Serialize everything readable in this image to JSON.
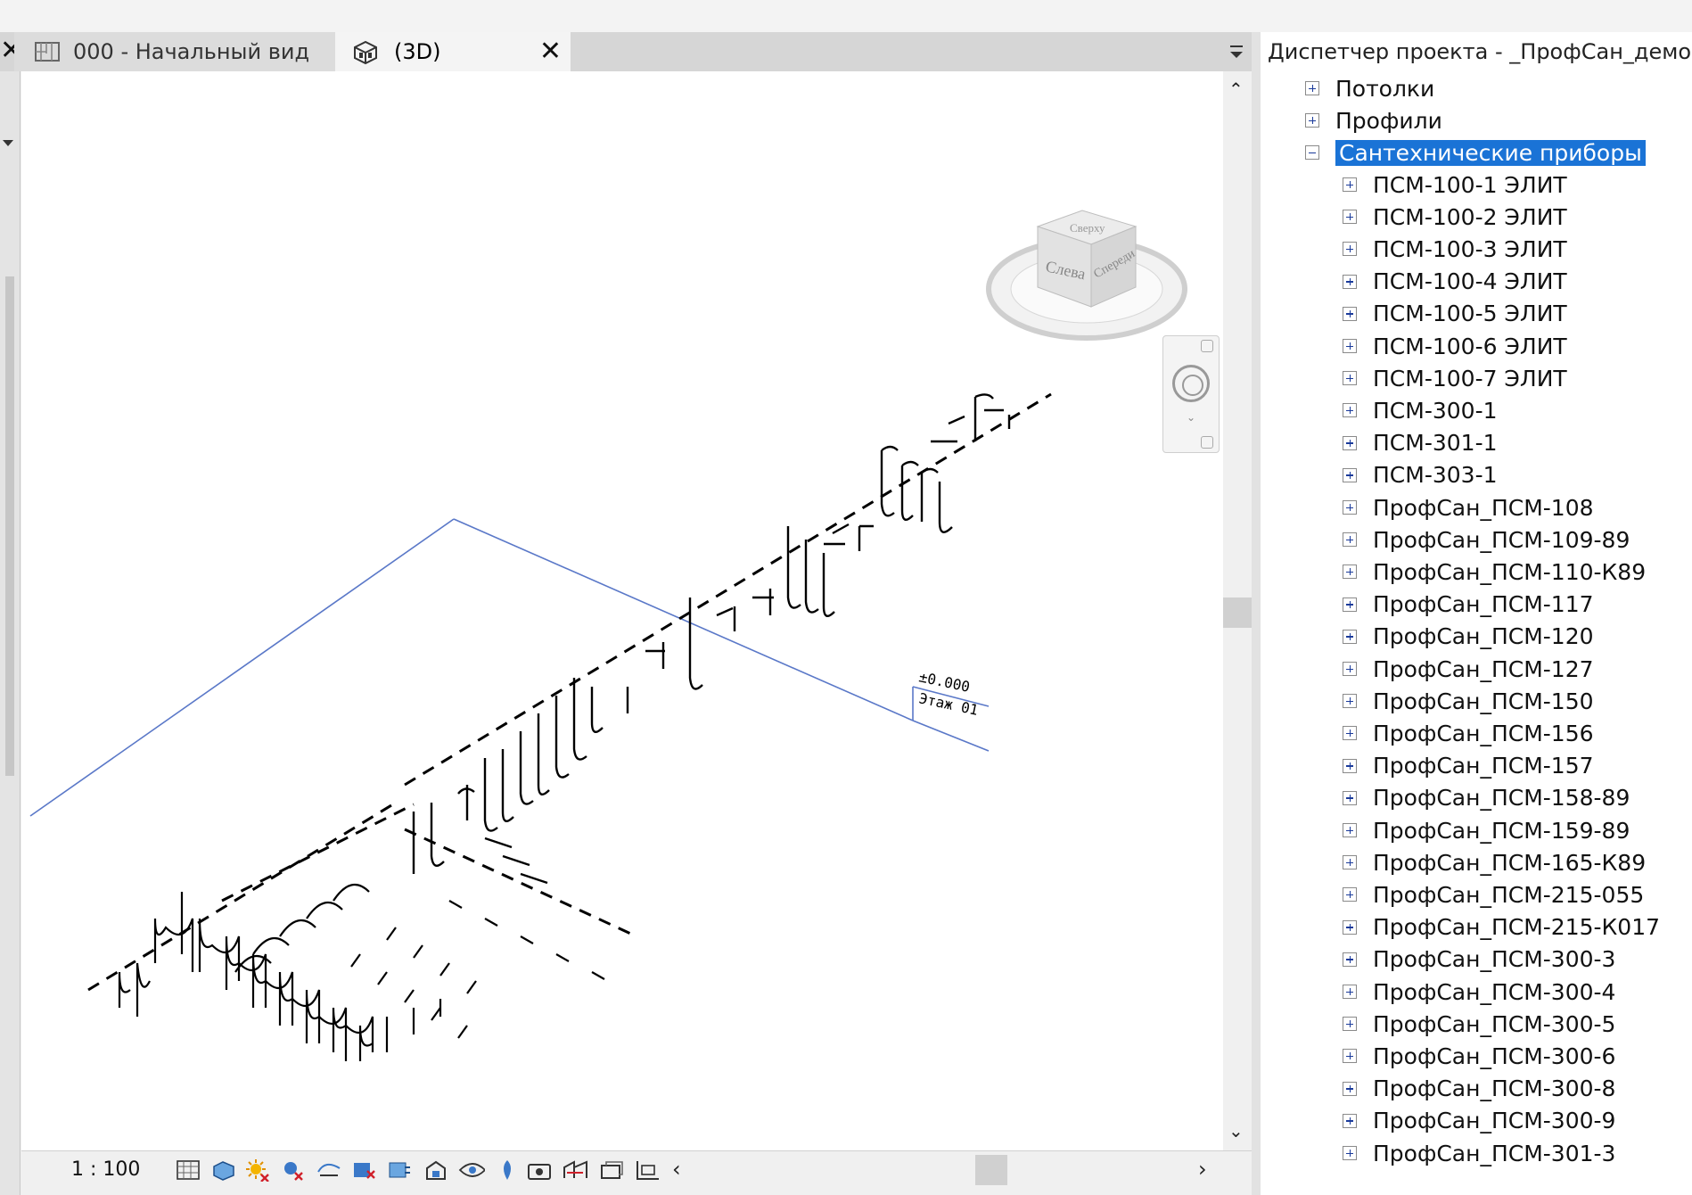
{
  "tabs": [
    {
      "label": "000 - Начальный вид",
      "icon": "floor-plan-icon",
      "active": false
    },
    {
      "label": "(3D)",
      "icon": "3d-view-icon",
      "active": true
    }
  ],
  "project_browser": {
    "title": "Диспетчер проекта - _ПрофСан_демонстр",
    "top_items": [
      {
        "label": "Потолки",
        "expanded": false
      },
      {
        "label": "Профили",
        "expanded": false
      },
      {
        "label": "Сантехнические приборы",
        "expanded": true,
        "selected": true
      }
    ],
    "children": [
      "ПСМ-100-1 ЭЛИТ",
      "ПСМ-100-2 ЭЛИТ",
      "ПСМ-100-3 ЭЛИТ",
      "ПСМ-100-4 ЭЛИТ",
      "ПСМ-100-5 ЭЛИТ",
      "ПСМ-100-6 ЭЛИТ",
      "ПСМ-100-7 ЭЛИТ",
      "ПСМ-300-1",
      "ПСМ-301-1",
      "ПСМ-303-1",
      "ПрофСан_ПСМ-108",
      "ПрофСан_ПСМ-109-89",
      "ПрофСан_ПСМ-110-К89",
      "ПрофСан_ПСМ-117",
      "ПрофСан_ПСМ-120",
      "ПрофСан_ПСМ-127",
      "ПрофСан_ПСМ-150",
      "ПрофСан_ПСМ-156",
      "ПрофСан_ПСМ-157",
      "ПрофСан_ПСМ-158-89",
      "ПрофСан_ПСМ-159-89",
      "ПрофСан_ПСМ-165-К89",
      "ПрофСан_ПСМ-215-055",
      "ПрофСан_ПСМ-215-К017",
      "ПрофСан_ПСМ-300-3",
      "ПрофСан_ПСМ-300-4",
      "ПрофСан_ПСМ-300-5",
      "ПрофСан_ПСМ-300-6",
      "ПрофСан_ПСМ-300-8",
      "ПрофСан_ПСМ-300-9",
      "ПрофСан_ПСМ-301-3"
    ]
  },
  "viewport": {
    "level_elevation": "±0.000",
    "level_name": "Этаж 01",
    "viewcube": {
      "front": "Слева",
      "right": "Спереди",
      "top": "Сверху"
    }
  },
  "status_bar": {
    "scale": "1 : 100",
    "icons": [
      "detail-level-icon",
      "visual-style-icon",
      "sun-path-off-icon",
      "shadows-off-icon",
      "show-rendering-icon",
      "crop-view-icon",
      "show-crop-region-icon",
      "unlock-3d-view-icon",
      "temporary-hide-icon",
      "reveal-hidden-icon",
      "worksharing-display-icon",
      "analytical-model-icon",
      "highlight-displacement-icon",
      "reveal-constraints-icon"
    ]
  },
  "colors": {
    "selection": "#1a73d6",
    "level_line": "#5a78c8",
    "tab_active": "#f4f4f4"
  }
}
